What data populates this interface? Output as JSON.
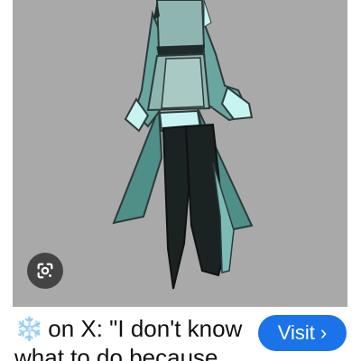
{
  "result": {
    "image_alt": "",
    "caption_icon": "snowflake-icon",
    "caption_icon_glyph": "❄️",
    "caption_line1": "on X: \"I don't know",
    "caption_line2": "what to do because",
    "visit_label": "Visit",
    "visit_chevron": "›",
    "lens_icon": "google-lens-icon"
  },
  "colors": {
    "image_background": "#a9a9a9",
    "visit_button": "#1a73e8",
    "lens_button": "#444444"
  }
}
